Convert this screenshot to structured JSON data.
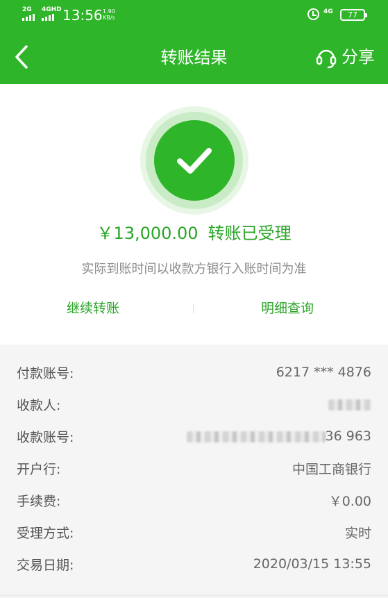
{
  "status_bar": {
    "sim1": "2G",
    "sim2": "4GHD",
    "time": "13:56",
    "speed_value": "1.90",
    "speed_unit": "KB/s",
    "network": "4G",
    "battery": "77"
  },
  "header": {
    "title": "转账结果",
    "share_label": "分享",
    "bg_color": "#2fb52a"
  },
  "result": {
    "amount": "￥13,000.00",
    "status": "转账已受理",
    "note": "实际到账时间以收款方银行入账时间为准",
    "continue_label": "继续转账",
    "details_label": "明细查询",
    "accent_color": "#2aa526"
  },
  "details": [
    {
      "label": "付款账号:",
      "value": "6217 *** 4876",
      "masked": false
    },
    {
      "label": "收款人:",
      "value": "",
      "masked": true
    },
    {
      "label": "收款账号:",
      "value": "36 963",
      "masked": true
    },
    {
      "label": "开户行:",
      "value": "中国工商银行",
      "masked": false
    },
    {
      "label": "手续费:",
      "value": "￥0.00",
      "masked": false
    },
    {
      "label": "受理方式:",
      "value": "实时",
      "masked": false
    },
    {
      "label": "交易日期:",
      "value": "2020/03/15  13:55",
      "masked": false
    }
  ]
}
